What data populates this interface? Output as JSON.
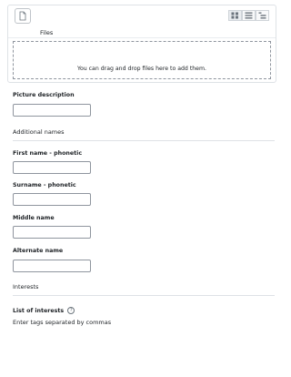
{
  "filepicker": {
    "path_label": "Files",
    "drop_text": "You can drag and drop files here to add them.",
    "add_icon": "file-icon",
    "view_icons": [
      "icon-view-icon",
      "list-view-icon",
      "tree-view-icon"
    ]
  },
  "fields": {
    "picture_description": {
      "label": "Picture description",
      "value": ""
    },
    "additional_names_heading": "Additional names",
    "first_name_phonetic": {
      "label": "First name - phonetic",
      "value": ""
    },
    "surname_phonetic": {
      "label": "Surname - phonetic",
      "value": ""
    },
    "middle_name": {
      "label": "Middle name",
      "value": ""
    },
    "alternate_name": {
      "label": "Alternate name",
      "value": ""
    },
    "interests_heading": "Interests",
    "list_of_interests": {
      "label": "List of interests",
      "hint": "Enter tags separated by commas"
    }
  },
  "colors": {
    "border": "#8f959e",
    "divider": "#dee2e6",
    "text": "#1d2125"
  }
}
